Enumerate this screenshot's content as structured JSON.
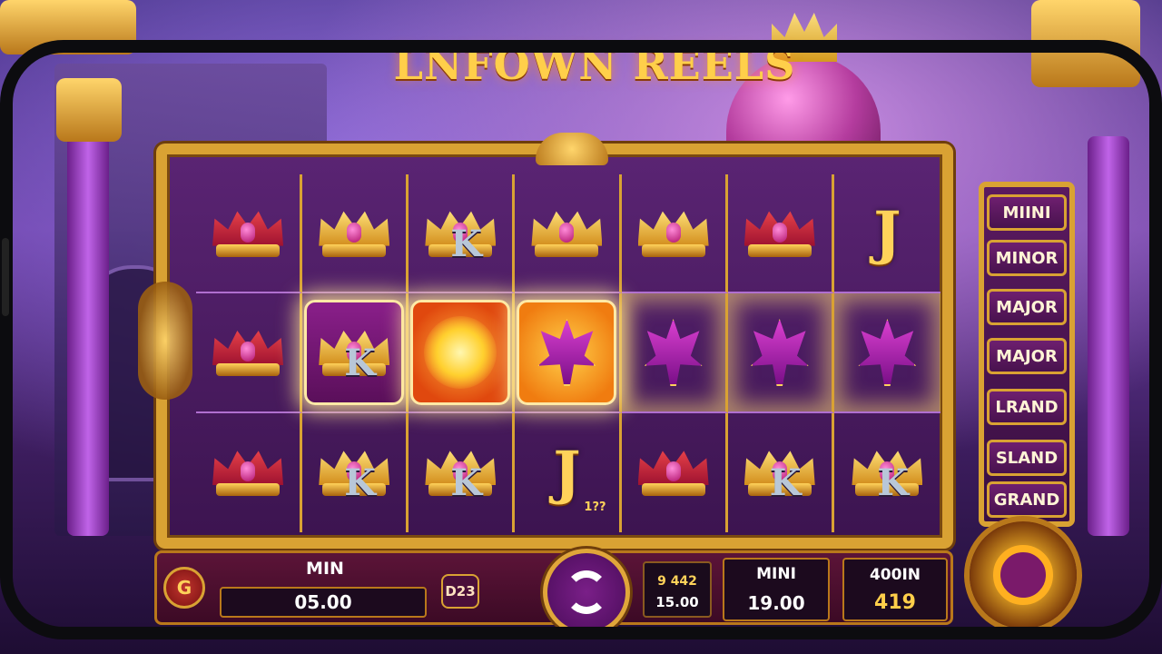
{
  "game": {
    "title": "LNFOWN REELS"
  },
  "reels": {
    "grid": [
      [
        "crown",
        "crown-gold",
        "k",
        "crown-gold",
        "crown-gold",
        "crown-red",
        "j"
      ],
      [
        "crown",
        "k",
        "burst",
        "fleur",
        "fleur",
        "fleur",
        "fleur"
      ],
      [
        "crown",
        "k",
        "k",
        "j-tag",
        "crown-red",
        "k",
        "k"
      ]
    ],
    "letters": {
      "j": "J",
      "k": "K"
    },
    "j_tag": "1??"
  },
  "jackpots": [
    "MIINI",
    "MINOR",
    "MAJOR",
    "MAJOR",
    "LRAND",
    "SLAND",
    "GRAND"
  ],
  "controls": {
    "min_label": "MIN",
    "min_value": "05.00",
    "bet_badge": "D23",
    "balance_line1": "9 442",
    "balance_line2": "15.00",
    "mini_label": "MINI",
    "mini_value": "19.00",
    "win_label": "400IN",
    "win_value": "419",
    "menu_glyph": "G"
  },
  "colors": {
    "gold": "#d9a233",
    "purple": "#5a2473",
    "text_gold": "#ffcf4a"
  }
}
